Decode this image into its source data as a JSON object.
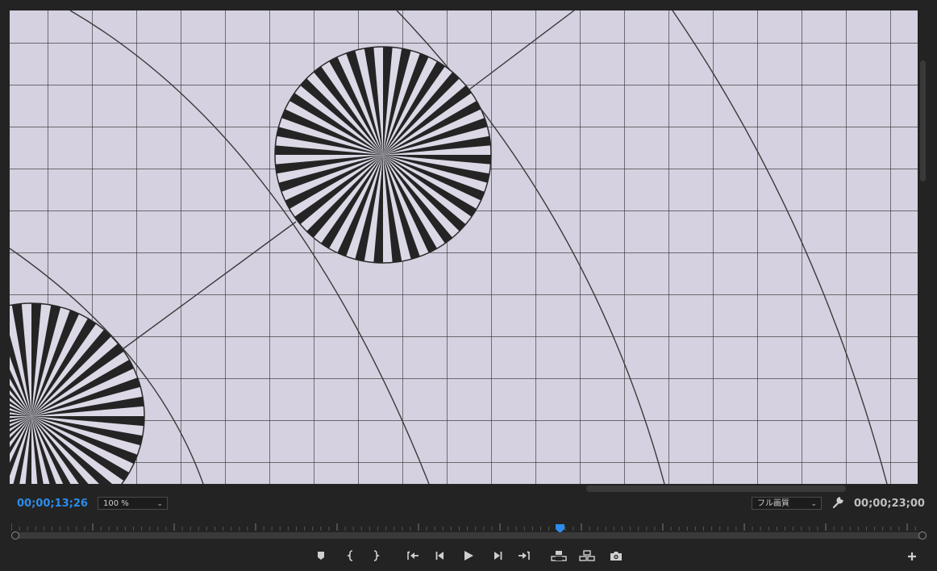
{
  "monitor": {
    "current_timecode": "00;00;13;26",
    "duration_timecode": "00;00;23;00",
    "zoom_label": "100 %",
    "quality_label": "フル画質",
    "playhead_fraction": 0.601
  },
  "icons": {
    "settings": "wrench-icon",
    "add_button": "plus-icon",
    "transport": [
      "marker-icon",
      "mark-in-icon",
      "mark-out-icon",
      "go-to-in-icon",
      "step-back-icon",
      "play-icon",
      "step-forward-icon",
      "go-to-out-icon",
      "lift-icon",
      "extract-icon",
      "camera-icon"
    ]
  },
  "colors": {
    "accent": "#2d8ceb",
    "panel_bg": "#232323",
    "frame_bg": "#d5d1e0"
  }
}
